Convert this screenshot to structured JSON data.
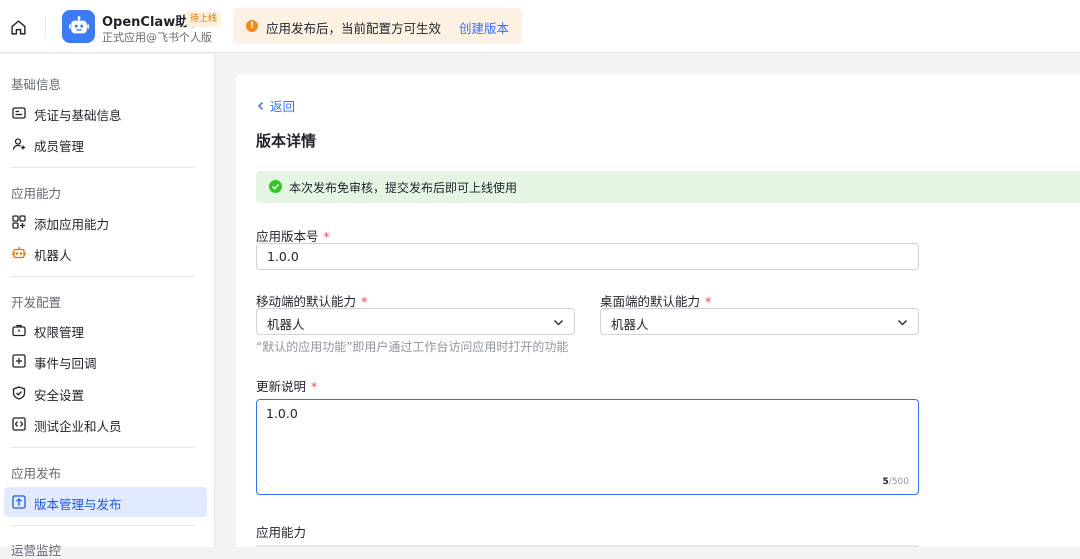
{
  "topbar": {
    "app_name": "OpenClaw助手",
    "app_badge": "待上线",
    "app_subtitle": "正式应用@飞书个人版",
    "notice_text": "应用发布后，当前配置方可生效",
    "notice_link": "创建版本"
  },
  "sidebar": {
    "sections": [
      {
        "title": "基础信息",
        "items": [
          {
            "label": "凭证与基础信息",
            "icon": "id-card-icon"
          },
          {
            "label": "成员管理",
            "icon": "user-add-icon"
          }
        ]
      },
      {
        "title": "应用能力",
        "items": [
          {
            "label": "添加应用能力",
            "icon": "apps-add-icon"
          },
          {
            "label": "机器人",
            "icon": "robot-icon"
          }
        ]
      },
      {
        "title": "开发配置",
        "items": [
          {
            "label": "权限管理",
            "icon": "briefcase-icon"
          },
          {
            "label": "事件与回调",
            "icon": "event-add-icon"
          },
          {
            "label": "安全设置",
            "icon": "shield-icon"
          },
          {
            "label": "测试企业和人员",
            "icon": "code-box-icon"
          }
        ]
      },
      {
        "title": "应用发布",
        "items": [
          {
            "label": "版本管理与发布",
            "icon": "upload-icon",
            "active": true
          }
        ]
      },
      {
        "title": "运营监控"
      }
    ]
  },
  "main": {
    "back_label": "返回",
    "page_title": "版本详情",
    "success_text": "本次发布免审核，提交发布后即可上线使用",
    "version_label": "应用版本号",
    "version_value": "1.0.0",
    "mobile_label": "移动端的默认能力",
    "mobile_value": "机器人",
    "desktop_label": "桌面端的默认能力",
    "desktop_value": "机器人",
    "hint": "“默认的应用功能”即用户通过工作台访问应用时打开的功能",
    "update_label": "更新说明",
    "update_value": "1.0.0",
    "counter_current": "5",
    "counter_max": "/500",
    "capability_label": "应用能力",
    "required_mark": "*"
  },
  "colors": {
    "accent": "#3370ff",
    "active_bg": "#e1eaff",
    "success_bg": "#e4f5e4",
    "warning_bg": "#fdf1e3",
    "required": "#f54a45"
  }
}
